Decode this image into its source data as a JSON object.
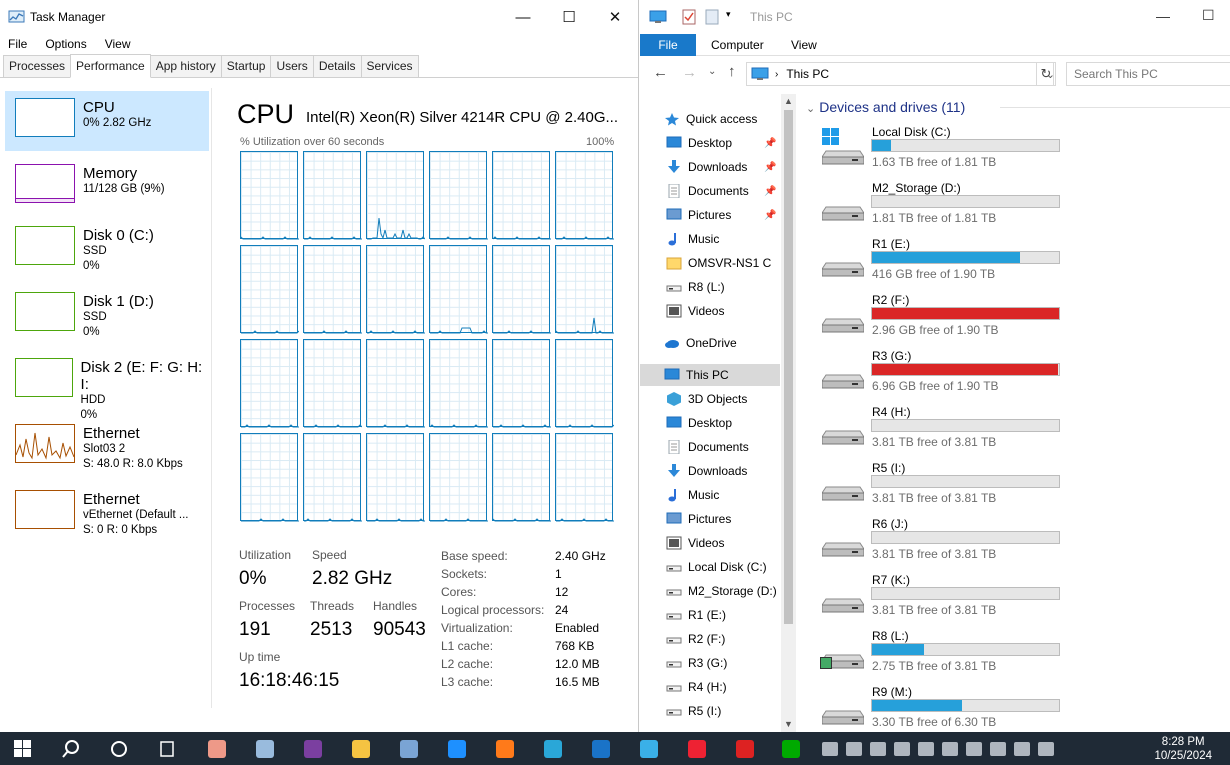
{
  "task_manager": {
    "title": "Task Manager",
    "window_buttons": {
      "minimize": "—",
      "maximize": "☐",
      "close": "✕"
    },
    "menu": [
      "File",
      "Options",
      "View"
    ],
    "tabs": [
      "Processes",
      "Performance",
      "App history",
      "Startup",
      "Users",
      "Details",
      "Services"
    ],
    "active_tab": "Performance",
    "side_items": [
      {
        "title": "CPU",
        "sub1": "0% 2.82 GHz",
        "sub2": "",
        "sub3": "",
        "color": "#117dbb"
      },
      {
        "title": "Memory",
        "sub1": "11/128 GB (9%)",
        "sub2": "",
        "sub3": "",
        "color": "#8b12ae"
      },
      {
        "title": "Disk 0 (C:)",
        "sub1": "SSD",
        "sub2": "0%",
        "sub3": "",
        "color": "#4da60c"
      },
      {
        "title": "Disk 1 (D:)",
        "sub1": "SSD",
        "sub2": "0%",
        "sub3": "",
        "color": "#4da60c"
      },
      {
        "title": "Disk 2 (E: F: G: H: I:",
        "sub1": "HDD",
        "sub2": "0%",
        "sub3": "",
        "color": "#4da60c"
      },
      {
        "title": "Ethernet",
        "sub1": "Slot03 2",
        "sub2": "S: 48.0  R: 8.0 Kbps",
        "sub3": "",
        "color": "#a74f01"
      },
      {
        "title": "Ethernet",
        "sub1": "vEthernet (Default ...",
        "sub2": "S: 0  R: 0 Kbps",
        "sub3": "",
        "color": "#a74f01"
      }
    ],
    "cpu": {
      "heading": "CPU",
      "name": "Intel(R) Xeon(R) Silver 4214R CPU @ 2.40G...",
      "util_label": "% Utilization over 60 seconds",
      "util_max": "100%",
      "stats": {
        "utilization_label": "Utilization",
        "utilization": "0%",
        "speed_label": "Speed",
        "speed": "2.82 GHz",
        "processes_label": "Processes",
        "processes": "191",
        "threads_label": "Threads",
        "threads": "2513",
        "handles_label": "Handles",
        "handles": "90543",
        "uptime_label": "Up time",
        "uptime": "16:18:46:15"
      },
      "details": [
        {
          "k": "Base speed:",
          "v": "2.40 GHz"
        },
        {
          "k": "Sockets:",
          "v": "1"
        },
        {
          "k": "Cores:",
          "v": "12"
        },
        {
          "k": "Logical processors:",
          "v": "24"
        },
        {
          "k": "Virtualization:",
          "v": "Enabled"
        },
        {
          "k": "L1 cache:",
          "v": "768 KB"
        },
        {
          "k": "L2 cache:",
          "v": "12.0 MB"
        },
        {
          "k": "L3 cache:",
          "v": "16.5 MB"
        }
      ]
    }
  },
  "explorer": {
    "title": "This PC",
    "ribbon_tabs": [
      "File",
      "Computer",
      "View"
    ],
    "address": "This PC",
    "search_placeholder": "Search This PC",
    "section": "Devices and drives (11)",
    "nav": [
      {
        "label": "Quick access",
        "indent": 0,
        "pin": false,
        "icon": "star-icon",
        "color": "#2b88d8"
      },
      {
        "label": "Desktop",
        "indent": 1,
        "pin": true,
        "icon": "desktop-icon",
        "color": "#2b88d8"
      },
      {
        "label": "Downloads",
        "indent": 1,
        "pin": true,
        "icon": "download-icon",
        "color": "#2b88d8"
      },
      {
        "label": "Documents",
        "indent": 1,
        "pin": true,
        "icon": "document-icon",
        "color": "#9aa4ae"
      },
      {
        "label": "Pictures",
        "indent": 1,
        "pin": true,
        "icon": "pictures-icon",
        "color": "#6b9bd1"
      },
      {
        "label": "Music",
        "indent": 1,
        "pin": false,
        "icon": "music-icon",
        "color": "#2b6fd8"
      },
      {
        "label": "OMSVR-NS1 C",
        "indent": 1,
        "pin": false,
        "icon": "folder-icon",
        "color": "#ffd86b"
      },
      {
        "label": "R8 (L:)",
        "indent": 1,
        "pin": false,
        "icon": "drive-icon",
        "color": "#777"
      },
      {
        "label": "Videos",
        "indent": 1,
        "pin": false,
        "icon": "videos-icon",
        "color": "#555"
      },
      {
        "label": "OneDrive",
        "indent": 0,
        "pin": false,
        "icon": "cloud-icon",
        "color": "#1e76d0"
      },
      {
        "label": "This PC",
        "indent": 0,
        "pin": false,
        "icon": "computer-icon",
        "color": "#2b88d8"
      },
      {
        "label": "3D Objects",
        "indent": 1,
        "pin": false,
        "icon": "cube-icon",
        "color": "#3aa0d8"
      },
      {
        "label": "Desktop",
        "indent": 1,
        "pin": false,
        "icon": "desktop-icon",
        "color": "#2b88d8"
      },
      {
        "label": "Documents",
        "indent": 1,
        "pin": false,
        "icon": "document-icon",
        "color": "#9aa4ae"
      },
      {
        "label": "Downloads",
        "indent": 1,
        "pin": false,
        "icon": "download-icon",
        "color": "#2b88d8"
      },
      {
        "label": "Music",
        "indent": 1,
        "pin": false,
        "icon": "music-icon",
        "color": "#2b6fd8"
      },
      {
        "label": "Pictures",
        "indent": 1,
        "pin": false,
        "icon": "pictures-icon",
        "color": "#6b9bd1"
      },
      {
        "label": "Videos",
        "indent": 1,
        "pin": false,
        "icon": "videos-icon",
        "color": "#555"
      },
      {
        "label": "Local Disk (C:)",
        "indent": 1,
        "pin": false,
        "icon": "drive-icon",
        "color": "#777"
      },
      {
        "label": "M2_Storage (D:)",
        "indent": 1,
        "pin": false,
        "icon": "drive-icon",
        "color": "#777"
      },
      {
        "label": "R1 (E:)",
        "indent": 1,
        "pin": false,
        "icon": "drive-icon",
        "color": "#777"
      },
      {
        "label": "R2 (F:)",
        "indent": 1,
        "pin": false,
        "icon": "drive-icon",
        "color": "#777"
      },
      {
        "label": "R3 (G:)",
        "indent": 1,
        "pin": false,
        "icon": "drive-icon",
        "color": "#777"
      },
      {
        "label": "R4 (H:)",
        "indent": 1,
        "pin": false,
        "icon": "drive-icon",
        "color": "#777"
      },
      {
        "label": "R5 (I:)",
        "indent": 1,
        "pin": false,
        "icon": "drive-icon",
        "color": "#777"
      }
    ],
    "selected_nav": "This PC",
    "drives": [
      {
        "name": "Local Disk (C:)",
        "free": "1.63 TB free of 1.81 TB",
        "used_fraction": 0.1,
        "color": "#26a0da",
        "windows": true,
        "usb": false
      },
      {
        "name": "M2_Storage (D:)",
        "free": "1.81 TB free of 1.81 TB",
        "used_fraction": 0.0,
        "color": "#26a0da",
        "windows": false,
        "usb": false
      },
      {
        "name": "R1 (E:)",
        "free": "416 GB free of 1.90 TB",
        "used_fraction": 0.79,
        "color": "#26a0da",
        "windows": false,
        "usb": false
      },
      {
        "name": "R2 (F:)",
        "free": "2.96 GB free of 1.90 TB",
        "used_fraction": 0.998,
        "color": "#da2626",
        "windows": false,
        "usb": false
      },
      {
        "name": "R3 (G:)",
        "free": "6.96 GB free of 1.90 TB",
        "used_fraction": 0.996,
        "color": "#da2626",
        "windows": false,
        "usb": false
      },
      {
        "name": "R4 (H:)",
        "free": "3.81 TB free of 3.81 TB",
        "used_fraction": 0.0,
        "color": "#26a0da",
        "windows": false,
        "usb": false
      },
      {
        "name": "R5 (I:)",
        "free": "3.81 TB free of 3.81 TB",
        "used_fraction": 0.0,
        "color": "#26a0da",
        "windows": false,
        "usb": false
      },
      {
        "name": "R6 (J:)",
        "free": "3.81 TB free of 3.81 TB",
        "used_fraction": 0.0,
        "color": "#26a0da",
        "windows": false,
        "usb": false
      },
      {
        "name": "R7 (K:)",
        "free": "3.81 TB free of 3.81 TB",
        "used_fraction": 0.0,
        "color": "#26a0da",
        "windows": false,
        "usb": false
      },
      {
        "name": "R8 (L:)",
        "free": "2.75 TB free of 3.81 TB",
        "used_fraction": 0.28,
        "color": "#26a0da",
        "windows": false,
        "usb": true
      },
      {
        "name": "R9 (M:)",
        "free": "3.30 TB free of 6.30 TB",
        "used_fraction": 0.48,
        "color": "#26a0da",
        "windows": false,
        "usb": false
      }
    ]
  },
  "taskbar": {
    "time": "8:28 PM",
    "date": "10/25/2024",
    "apps": [
      "start-icon",
      "search-icon",
      "cortana-icon",
      "task-view-icon",
      "paint-icon",
      "network-icon",
      "onenote-icon",
      "file-explorer-icon",
      "remote-desktop-icon",
      "ie-icon",
      "firefox-icon",
      "edge-icon",
      "outlook-icon",
      "vpn-icon",
      "chrome-icon",
      "app-icon",
      "xbox-icon"
    ]
  }
}
